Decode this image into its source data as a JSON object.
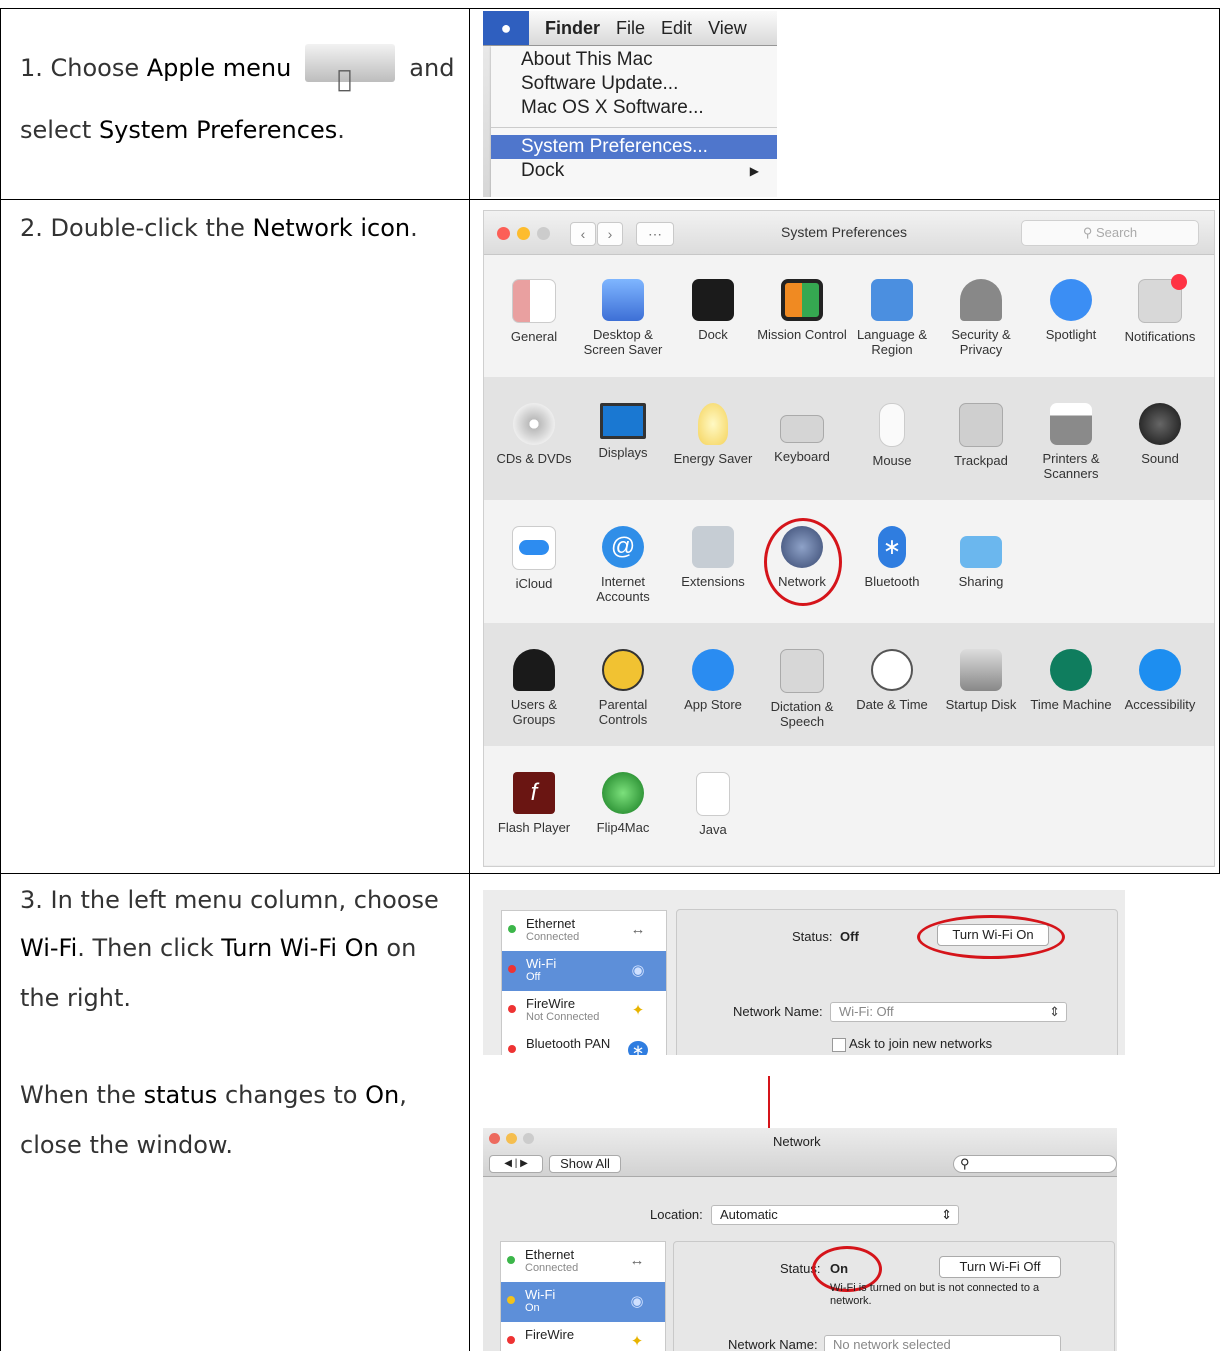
{
  "step1": {
    "text_a": "1. Choose ",
    "bold_a": "Apple menu",
    "text_b": "and",
    "text_c": "select ",
    "bold_b": "System Preferences",
    "text_d": "."
  },
  "step2": {
    "text_a": "2. Double-click the ",
    "bold_a": "Network icon",
    "text_b": "."
  },
  "step3": {
    "l1": "3. In the left menu column, choose",
    "bold_a": "Wi-Fi",
    "t2": ". Then click ",
    "bold_b": "Turn Wi-Fi On",
    "t3": " on",
    "l3": "the right.",
    "l4a": "When the ",
    "bold_c": "status",
    "l4b": " changes to ",
    "bold_d": "On",
    "l4c": ",",
    "l5": "close the window."
  },
  "menu": {
    "bar": [
      "Finder",
      "File",
      "Edit",
      "View"
    ],
    "items": [
      "About This Mac",
      "Software Update...",
      "Mac OS X Software...",
      "System Preferences...",
      "Dock"
    ]
  },
  "prefs": {
    "title": "System Preferences",
    "search_placeholder": "Search",
    "rows": [
      [
        "General",
        "Desktop & Screen Saver",
        "Dock",
        "Mission Control",
        "Language & Region",
        "Security & Privacy",
        "Spotlight",
        "Notifications"
      ],
      [
        "CDs & DVDs",
        "Displays",
        "Energy Saver",
        "Keyboard",
        "Mouse",
        "Trackpad",
        "Printers & Scanners",
        "Sound"
      ],
      [
        "iCloud",
        "Internet Accounts",
        "Extensions",
        "Network",
        "Bluetooth",
        "Sharing"
      ],
      [
        "Users & Groups",
        "Parental Controls",
        "App Store",
        "Dictation & Speech",
        "Date & Time",
        "Startup Disk",
        "Time Machine",
        "Accessibility"
      ],
      [
        "Flash Player",
        "Flip4Mac",
        "Java"
      ]
    ]
  },
  "net1": {
    "sidebar": [
      {
        "name": "Ethernet",
        "sub": "Connected"
      },
      {
        "name": "Wi-Fi",
        "sub": "Off"
      },
      {
        "name": "FireWire",
        "sub": "Not Connected"
      },
      {
        "name": "Bluetooth PAN",
        "sub": ""
      }
    ],
    "status_label": "Status:",
    "status_value": "Off",
    "button": "Turn Wi-Fi On",
    "network_name_label": "Network Name:",
    "network_name_value": "Wi-Fi: Off",
    "ask_join": "Ask to join new networks"
  },
  "net2": {
    "title": "Network",
    "show_all": "Show All",
    "location_label": "Location:",
    "location_value": "Automatic",
    "sidebar": [
      {
        "name": "Ethernet",
        "sub": "Connected"
      },
      {
        "name": "Wi-Fi",
        "sub": "On"
      },
      {
        "name": "FireWire",
        "sub": ""
      }
    ],
    "status_label": "Status:",
    "status_value": "On",
    "button": "Turn Wi-Fi Off",
    "note": "Wi-Fi is turned on but is not connected to a network.",
    "network_name_label": "Network Name:",
    "network_name_value": "No network selected"
  }
}
